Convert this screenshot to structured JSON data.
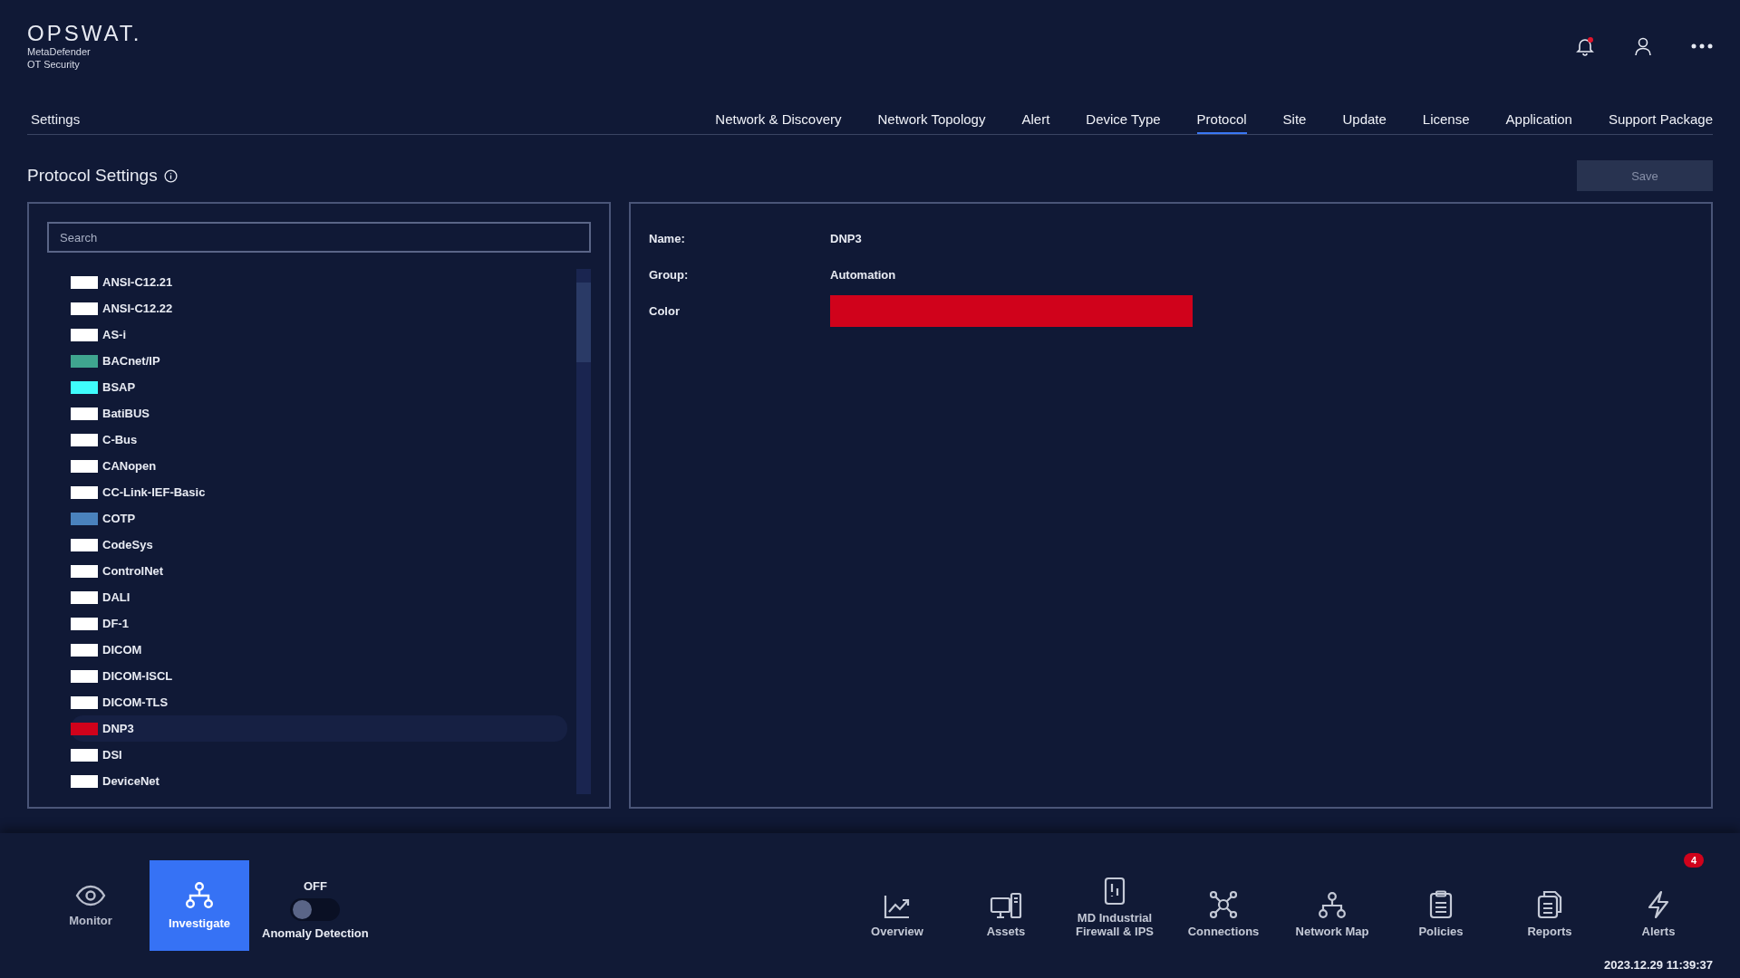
{
  "header": {
    "logo": "OPSWAT.",
    "product": [
      "MetaDefender",
      "OT Security"
    ],
    "notification_unread": true
  },
  "nav": {
    "title": "Settings",
    "tabs": [
      {
        "label": "Network & Discovery",
        "selected": false
      },
      {
        "label": "Network Topology",
        "selected": false
      },
      {
        "label": "Alert",
        "selected": false
      },
      {
        "label": "Device Type",
        "selected": false
      },
      {
        "label": "Protocol",
        "selected": true
      },
      {
        "label": "Site",
        "selected": false
      },
      {
        "label": "Update",
        "selected": false
      },
      {
        "label": "License",
        "selected": false
      },
      {
        "label": "Application",
        "selected": false
      },
      {
        "label": "Support Package",
        "selected": false
      }
    ]
  },
  "page": {
    "title": "Protocol Settings",
    "save": {
      "label": "Save",
      "disabled": true
    }
  },
  "search": {
    "placeholder": "Search"
  },
  "protocols": [
    {
      "name": "ANSI-C12.21",
      "color": "#ffffff",
      "selected": false
    },
    {
      "name": "ANSI-C12.22",
      "color": "#ffffff",
      "selected": false
    },
    {
      "name": "AS-i",
      "color": "#ffffff",
      "selected": false
    },
    {
      "name": "BACnet/IP",
      "color": "#3fa58f",
      "selected": false
    },
    {
      "name": "BSAP",
      "color": "#3ffcfc",
      "selected": false
    },
    {
      "name": "BatiBUS",
      "color": "#ffffff",
      "selected": false
    },
    {
      "name": "C-Bus",
      "color": "#ffffff",
      "selected": false
    },
    {
      "name": "CANopen",
      "color": "#ffffff",
      "selected": false
    },
    {
      "name": "CC-Link-IEF-Basic",
      "color": "#ffffff",
      "selected": false
    },
    {
      "name": "COTP",
      "color": "#4a82bd",
      "selected": false
    },
    {
      "name": "CodeSys",
      "color": "#ffffff",
      "selected": false
    },
    {
      "name": "ControlNet",
      "color": "#ffffff",
      "selected": false
    },
    {
      "name": "DALI",
      "color": "#ffffff",
      "selected": false
    },
    {
      "name": "DF-1",
      "color": "#ffffff",
      "selected": false
    },
    {
      "name": "DICOM",
      "color": "#ffffff",
      "selected": false
    },
    {
      "name": "DICOM-ISCL",
      "color": "#ffffff",
      "selected": false
    },
    {
      "name": "DICOM-TLS",
      "color": "#ffffff",
      "selected": false
    },
    {
      "name": "DNP3",
      "color": "#d0021b",
      "selected": true
    },
    {
      "name": "DSI",
      "color": "#ffffff",
      "selected": false
    },
    {
      "name": "DeviceNet",
      "color": "#ffffff",
      "selected": false
    }
  ],
  "detail": [
    {
      "kind": "text",
      "label": "Name:",
      "value": "DNP3"
    },
    {
      "kind": "text",
      "label": "Group:",
      "value": "Automation"
    },
    {
      "kind": "color",
      "label": "Color",
      "color": "#d0021b"
    }
  ],
  "modes": [
    {
      "label": "Monitor",
      "selected": false
    },
    {
      "label": "Investigate",
      "selected": true
    }
  ],
  "anomaly": {
    "state": "OFF",
    "on": false,
    "label": "Anomaly Detection"
  },
  "bottom_nav": [
    {
      "label": "Overview"
    },
    {
      "label": "Assets"
    },
    {
      "label": "MD Industrial Firewall & IPS"
    },
    {
      "label": "Connections"
    },
    {
      "label": "Network Map"
    },
    {
      "label": "Policies"
    },
    {
      "label": "Reports"
    },
    {
      "label": "Alerts",
      "badge": "4"
    }
  ],
  "timestamp": "2023.12.29 11:39:37"
}
